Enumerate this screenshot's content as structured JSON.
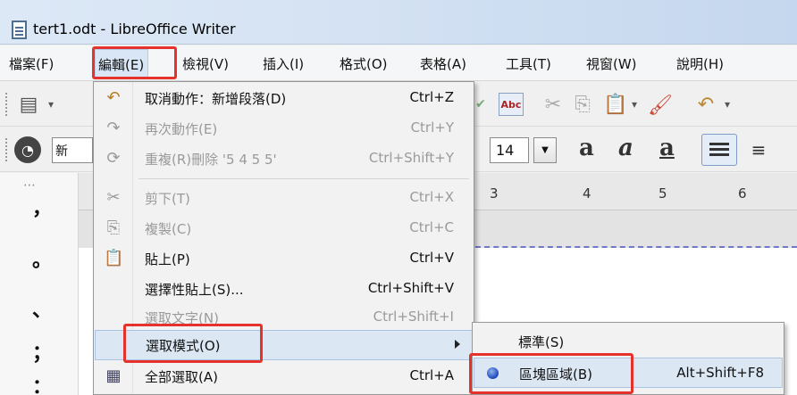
{
  "window": {
    "title": "tert1.odt - LibreOffice Writer"
  },
  "menubar": {
    "items": [
      "檔案(F)",
      "編輯(E)",
      "檢視(V)",
      "插入(I)",
      "格式(O)",
      "表格(A)",
      "工具(T)",
      "視窗(W)",
      "說明(H)"
    ],
    "active": "編輯(E)"
  },
  "toolbar": {
    "font_size": "14",
    "style_letters": [
      "a",
      "a",
      "a"
    ]
  },
  "ruler": {
    "numbers": [
      "3",
      "4",
      "5",
      "6"
    ]
  },
  "left_pane": {
    "punctuation": [
      "，",
      "。",
      "、",
      "；",
      "："
    ]
  },
  "edit_menu": {
    "items": [
      {
        "label": "取消動作：新增段落(D)",
        "shortcut": "Ctrl+Z",
        "icon": "undo-icon",
        "disabled": false
      },
      {
        "label": "再次動作(E)",
        "shortcut": "Ctrl+Y",
        "icon": "redo-icon",
        "disabled": true
      },
      {
        "label": "重複(R)刪除 '5 4 5 5'",
        "shortcut": "Ctrl+Shift+Y",
        "icon": "repeat-icon",
        "disabled": true
      },
      {
        "label": "剪下(T)",
        "shortcut": "Ctrl+X",
        "icon": "scissors-icon",
        "disabled": true
      },
      {
        "label": "複製(C)",
        "shortcut": "Ctrl+C",
        "icon": "copy-icon",
        "disabled": true
      },
      {
        "label": "貼上(P)",
        "shortcut": "Ctrl+V",
        "icon": "paste-icon",
        "disabled": false
      },
      {
        "label": "選擇性貼上(S)...",
        "shortcut": "Ctrl+Shift+V",
        "icon": "",
        "disabled": false
      },
      {
        "label": "選取文字(N)",
        "shortcut": "Ctrl+Shift+I",
        "icon": "",
        "disabled": true
      },
      {
        "label": "選取模式(O)",
        "shortcut": "",
        "icon": "",
        "disabled": false
      },
      {
        "label": "全部選取(A)",
        "shortcut": "Ctrl+A",
        "icon": "select-all-icon",
        "disabled": false
      }
    ]
  },
  "selection_submenu": {
    "items": [
      {
        "label": "標準(S)",
        "shortcut": ""
      },
      {
        "label": "區塊區域(B)",
        "shortcut": "Alt+Shift+F8"
      }
    ]
  },
  "colors": {
    "highlight_border": "#e5322d",
    "menu_highlight": "#dce7f4"
  }
}
